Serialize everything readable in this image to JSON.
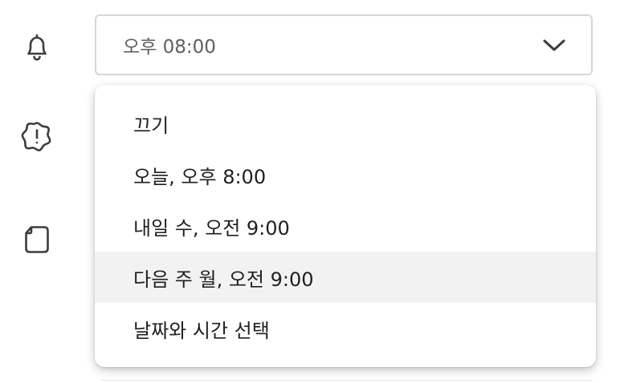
{
  "sidebar": {
    "icons": [
      "bell-icon",
      "alert-badge-icon",
      "note-icon"
    ]
  },
  "reminder_select": {
    "value": "오후 08:00",
    "chevron_icon": "chevron-down-icon"
  },
  "menu": {
    "items": [
      {
        "label": "끄기",
        "highlighted": false
      },
      {
        "label": "오늘, 오후 8:00",
        "highlighted": false
      },
      {
        "label": "내일 수, 오전 9:00",
        "highlighted": false
      },
      {
        "label": "다음 주 월, 오전 9:00",
        "highlighted": true
      },
      {
        "label": "날짜와 시간 선택",
        "highlighted": false
      }
    ]
  },
  "colors": {
    "menu_highlight": "#f2f2f2",
    "border": "#d6d6d6",
    "icon": "#3c3c3c"
  }
}
